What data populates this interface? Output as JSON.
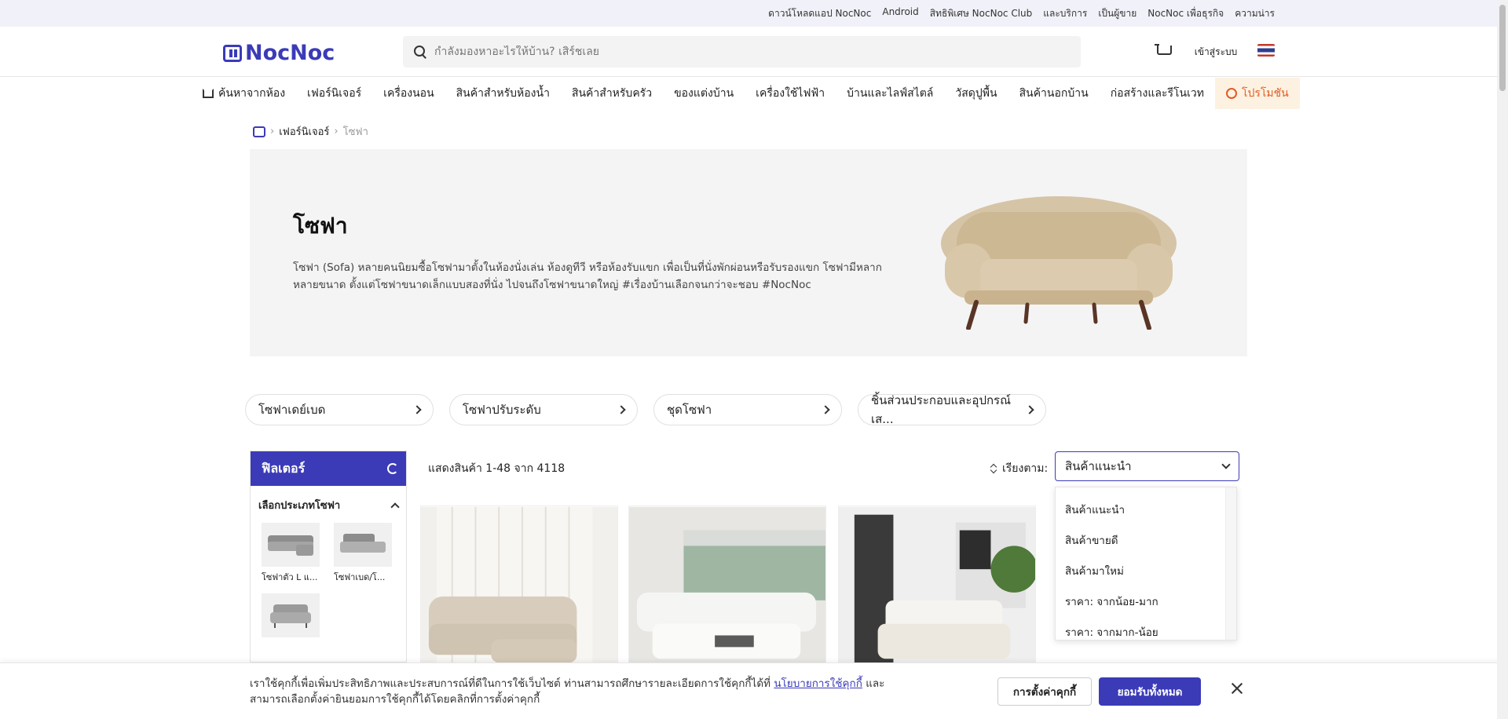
{
  "topbar": {
    "links": [
      "ดาวน์โหลดแอป NocNoc",
      "Android",
      "สิทธิพิเศษ NocNoc Club",
      "และบริการ",
      "เป็นผู้ขาย",
      "NocNoc เพื่อธุรกิจ",
      "ความน่าร"
    ]
  },
  "header": {
    "logo_text": "NocNoc",
    "search_placeholder": "กำลังมองหาอะไรให้บ้าน? เสิร์ชเลย",
    "login_label": "เข้าสู่ระบบ"
  },
  "categories": [
    "ค้นหาจากห้อง",
    "เฟอร์นิเจอร์",
    "เครื่องนอน",
    "สินค้าสำหรับห้องน้ำ",
    "สินค้าสำหรับครัว",
    "ของแต่งบ้าน",
    "เครื่องใช้ไฟฟ้า",
    "บ้านและไลฟ์สไตล์",
    "วัสดุปูพื้น",
    "สินค้านอกบ้าน",
    "ก่อสร้างและรีโนเวท",
    "โปรโมชัน"
  ],
  "breadcrumb": {
    "level1": "เฟอร์นิเจอร์",
    "current": "โซฟา"
  },
  "hero": {
    "title": "โซฟา",
    "description": "โซฟา (Sofa) หลายคนนิยมซื้อโซฟามาตั้งในห้องนั่งเล่น ห้องดูทีวี หรือห้องรับแขก เพื่อเป็นที่นั่งพักผ่อนหรือรับรองแขก โซฟามีหลากหลายขนาด ตั้งแต่โซฟาขนาดเล็กแบบสองที่นั่ง ไปจนถึงโซฟาขนาดใหญ่ #เรื่องบ้านเลือกจนกว่าจะชอบ #NocNoc"
  },
  "subcategories": [
    "โซฟาเดย์เบด",
    "โซฟาปรับระดับ",
    "ชุดโซฟา",
    "ชิ้นส่วนประกอบและอุปกรณ์เส..."
  ],
  "filter": {
    "title": "ฟิลเตอร์",
    "group_title": "เลือกประเภทโซฟา",
    "types": [
      "โซฟาตัว L แ...",
      "โซฟาเบด/โ...",
      ""
    ]
  },
  "results": {
    "count_text": "แสดงสินค้า 1-48 จาก 4118"
  },
  "sort": {
    "label": "เรียงตาม:",
    "selected": "สินค้าแนะนำ",
    "options": [
      "สินค้าแนะนำ",
      "สินค้าขายดี",
      "สินค้ามาใหม่",
      "ราคา: จากน้อย-มาก",
      "ราคา: จากมาก-น้อย"
    ]
  },
  "cookie": {
    "text_before": "เราใช้คุกกี้เพื่อเพิ่มประสิทธิภาพและประสบการณ์ที่ดีในการใช้เว็บไซต์ ท่านสามารถศึกษารายละเอียดการใช้คุกกี้ได้ที่ ",
    "link": "นโยบายการใช้คุกกี้",
    "text_after": " และสามารถเลือกตั้งค่ายินยอมการใช้คุกกี้ได้โดยคลิกที่การตั้งค่าคุกกี้",
    "settings_label": "การตั้งค่าคุกกี้",
    "accept_label": "ยอมรับทั้งหมด"
  },
  "colors": {
    "brand": "#3b3bb8",
    "promo": "#e05d23",
    "hero_bg": "#f4f4f4"
  }
}
